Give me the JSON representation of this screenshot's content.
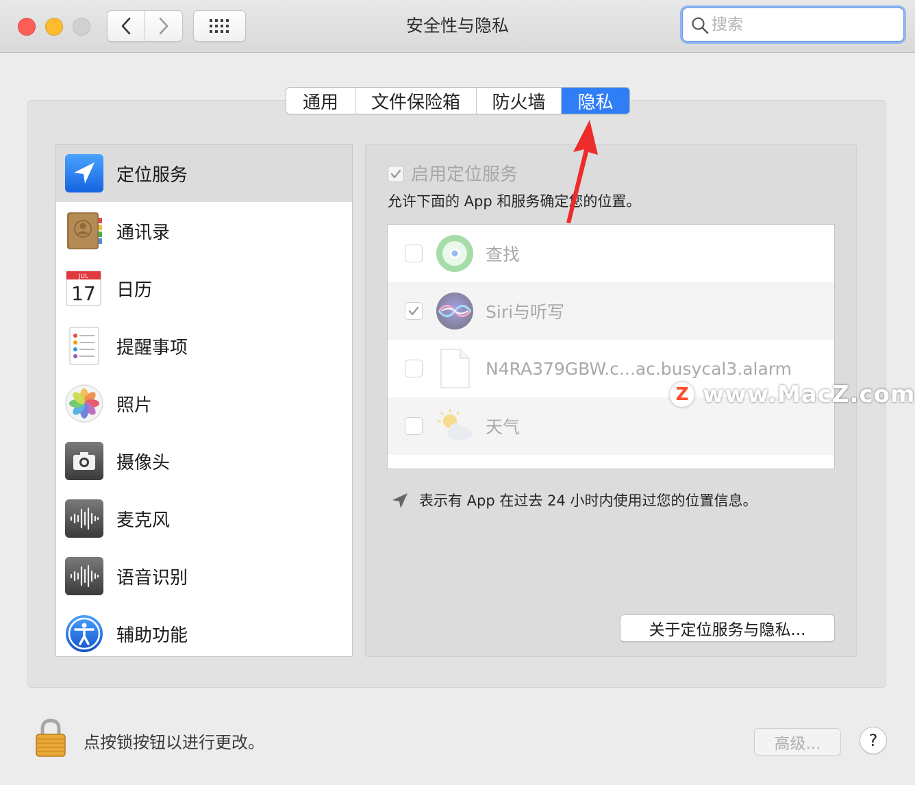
{
  "window": {
    "title": "安全性与隐私",
    "search_placeholder": "搜索"
  },
  "tabs": [
    {
      "label": "通用",
      "active": false
    },
    {
      "label": "文件保险箱",
      "active": false
    },
    {
      "label": "防火墙",
      "active": false
    },
    {
      "label": "隐私",
      "active": true
    }
  ],
  "sidebar": {
    "items": [
      {
        "label": "定位服务",
        "icon": "location-arrow-icon",
        "selected": true
      },
      {
        "label": "通讯录",
        "icon": "contacts-icon"
      },
      {
        "label": "日历",
        "icon": "calendar-icon",
        "calendar_month": "JUL",
        "calendar_day": "17"
      },
      {
        "label": "提醒事项",
        "icon": "reminders-icon"
      },
      {
        "label": "照片",
        "icon": "photos-icon"
      },
      {
        "label": "摄像头",
        "icon": "camera-icon"
      },
      {
        "label": "麦克风",
        "icon": "microphone-icon"
      },
      {
        "label": "语音识别",
        "icon": "speech-recognition-icon"
      },
      {
        "label": "辅助功能",
        "icon": "accessibility-icon"
      }
    ]
  },
  "location": {
    "enable_label": "启用定位服务",
    "enable_checked": true,
    "description": "允许下面的 App 和服务确定您的位置。",
    "apps": [
      {
        "label": "查找",
        "checked": false,
        "icon": "find-my-icon"
      },
      {
        "label": "Siri与听写",
        "checked": true,
        "icon": "siri-icon"
      },
      {
        "label": "N4RA379GBW.c...ac.busycal3.alarm",
        "checked": false,
        "icon": "document-icon"
      },
      {
        "label": "天气",
        "checked": false,
        "icon": "weather-icon"
      }
    ],
    "hint": "表示有 App 在过去 24 小时内使用过您的位置信息。",
    "about_button": "关于定位服务与隐私..."
  },
  "footer": {
    "lock_label": "点按锁按钮以进行更改。",
    "advanced_button": "高级...",
    "help_button": "?"
  },
  "watermark": {
    "badge": "Z",
    "text": "www.MacZ.com"
  },
  "colors": {
    "accent": "#2f7ef6",
    "annotation_arrow": "#ee2b2b"
  }
}
